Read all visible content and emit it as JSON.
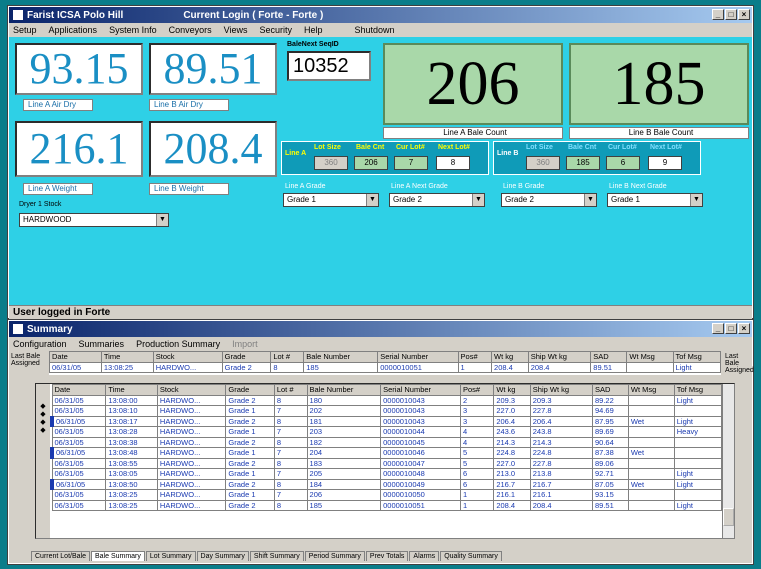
{
  "top_window": {
    "title": "Farist ICSA Polo Hill",
    "login": "Current Login ( Forte - Forte )",
    "menu": [
      "Setup",
      "Applications",
      "System Info",
      "Conveyors",
      "Views",
      "Security",
      "Help",
      "Shutdown"
    ],
    "readouts": [
      {
        "value": "93.15",
        "label": "Line A  Air Dry"
      },
      {
        "value": "89.51",
        "label": "Line B  Air Dry"
      },
      {
        "value": "216.1",
        "label": "Line A  Weight"
      },
      {
        "value": "208.4",
        "label": "Line B  Weight"
      }
    ],
    "bale_next_label": "BaleNext SeqID",
    "bale_next_value": "10352",
    "big_counts": [
      {
        "value": "206",
        "label": "Line A  Bale Count"
      },
      {
        "value": "185",
        "label": "Line B  Bale Count"
      }
    ],
    "line_a": {
      "name": "Line A",
      "headers": [
        "Lot Size",
        "Bale Cnt",
        "Cur Lot#",
        "Next Lot#"
      ],
      "values": [
        "360",
        "206",
        "7",
        "8"
      ]
    },
    "line_b": {
      "name": "Line B",
      "headers": [
        "Lot Size",
        "Bale Cnt",
        "Cur Lot#",
        "Next Lot#"
      ],
      "values": [
        "360",
        "185",
        "6",
        "9"
      ]
    },
    "grades": [
      {
        "label": "Line A Grade",
        "value": "Grade 1"
      },
      {
        "label": "Line A Next Grade",
        "value": "Grade 2"
      },
      {
        "label": "Line B Grade",
        "value": "Grade 2"
      },
      {
        "label": "Line B Next Grade",
        "value": "Grade 1"
      }
    ],
    "stock_label": "Dryer 1    Stock",
    "stock_value": "HARDWOOD",
    "status": "User logged in Forte"
  },
  "summary_window": {
    "title": "Summary",
    "menu": [
      "Configuration",
      "Summaries",
      "Production Summary",
      "Import"
    ],
    "side_label_left": "Last Bale Assigned",
    "side_label_right": "Last Bale Assigned",
    "columns": [
      "Date",
      "Time",
      "Stock",
      "Grade",
      "Lot #",
      "Bale Number",
      "Serial Number",
      "Pos#",
      "Wt kg",
      "Ship Wt kg",
      "SAD",
      "Wt Msg",
      "Tof Msg"
    ],
    "last_row": [
      "06/31/05",
      "13:08:25",
      "HARDWO...",
      "Grade 2",
      "8",
      "185",
      "0000010051",
      "1",
      "208.4",
      "208.4",
      "89.51",
      "",
      "Light"
    ],
    "rows": [
      [
        "06/31/05",
        "13:08:00",
        "HARDWO...",
        "Grade 2",
        "8",
        "180",
        "0000010043",
        "2",
        "209.3",
        "209.3",
        "89.22",
        "",
        "Light"
      ],
      [
        "06/31/05",
        "13:08:10",
        "HARDWO...",
        "Grade 1",
        "7",
        "202",
        "0000010043",
        "3",
        "227.0",
        "227.8",
        "94.69",
        "",
        ""
      ],
      [
        "06/31/05",
        "13:08:17",
        "HARDWO...",
        "Grade 2",
        "8",
        "181",
        "0000010043",
        "3",
        "206.4",
        "206.4",
        "87.95",
        "Wet",
        "Light"
      ],
      [
        "06/31/05",
        "13:08:28",
        "HARDWO...",
        "Grade 1",
        "7",
        "203",
        "0000010044",
        "4",
        "243.6",
        "243.8",
        "89.69",
        "",
        "Heavy"
      ],
      [
        "06/31/05",
        "13:08:38",
        "HARDWO...",
        "Grade 2",
        "8",
        "182",
        "0000010045",
        "4",
        "214.3",
        "214.3",
        "90.64",
        "",
        ""
      ],
      [
        "06/31/05",
        "13:08:48",
        "HARDWO...",
        "Grade 1",
        "7",
        "204",
        "0000010046",
        "5",
        "224.8",
        "224.8",
        "87.38",
        "Wet",
        ""
      ],
      [
        "06/31/05",
        "13:08:55",
        "HARDWO...",
        "Grade 2",
        "8",
        "183",
        "0000010047",
        "5",
        "227.0",
        "227.8",
        "89.06",
        "",
        ""
      ],
      [
        "06/31/05",
        "13:08:05",
        "HARDWO...",
        "Grade 1",
        "7",
        "205",
        "0000010048",
        "6",
        "213.0",
        "213.8",
        "92.71",
        "",
        "Light"
      ],
      [
        "06/31/05",
        "13:08:50",
        "HARDWO...",
        "Grade 2",
        "8",
        "184",
        "0000010049",
        "6",
        "216.7",
        "216.7",
        "87.05",
        "Wet",
        "Light"
      ],
      [
        "06/31/05",
        "13:08:25",
        "HARDWO...",
        "Grade 1",
        "7",
        "206",
        "0000010050",
        "1",
        "216.1",
        "216.1",
        "93.15",
        "",
        ""
      ],
      [
        "06/31/05",
        "13:08:25",
        "HARDWO...",
        "Grade 2",
        "8",
        "185",
        "0000010051",
        "1",
        "208.4",
        "208.4",
        "89.51",
        "",
        "Light"
      ]
    ],
    "marked_rows": [
      2,
      5,
      8
    ],
    "tabs": [
      "Current Lot/Bale",
      "Bale Summary",
      "Lot Summary",
      "Day Summary",
      "Shift Summary",
      "Period Summary",
      "Prev Totals",
      "Alarms",
      "Quality Summary"
    ],
    "active_tab": 1
  }
}
